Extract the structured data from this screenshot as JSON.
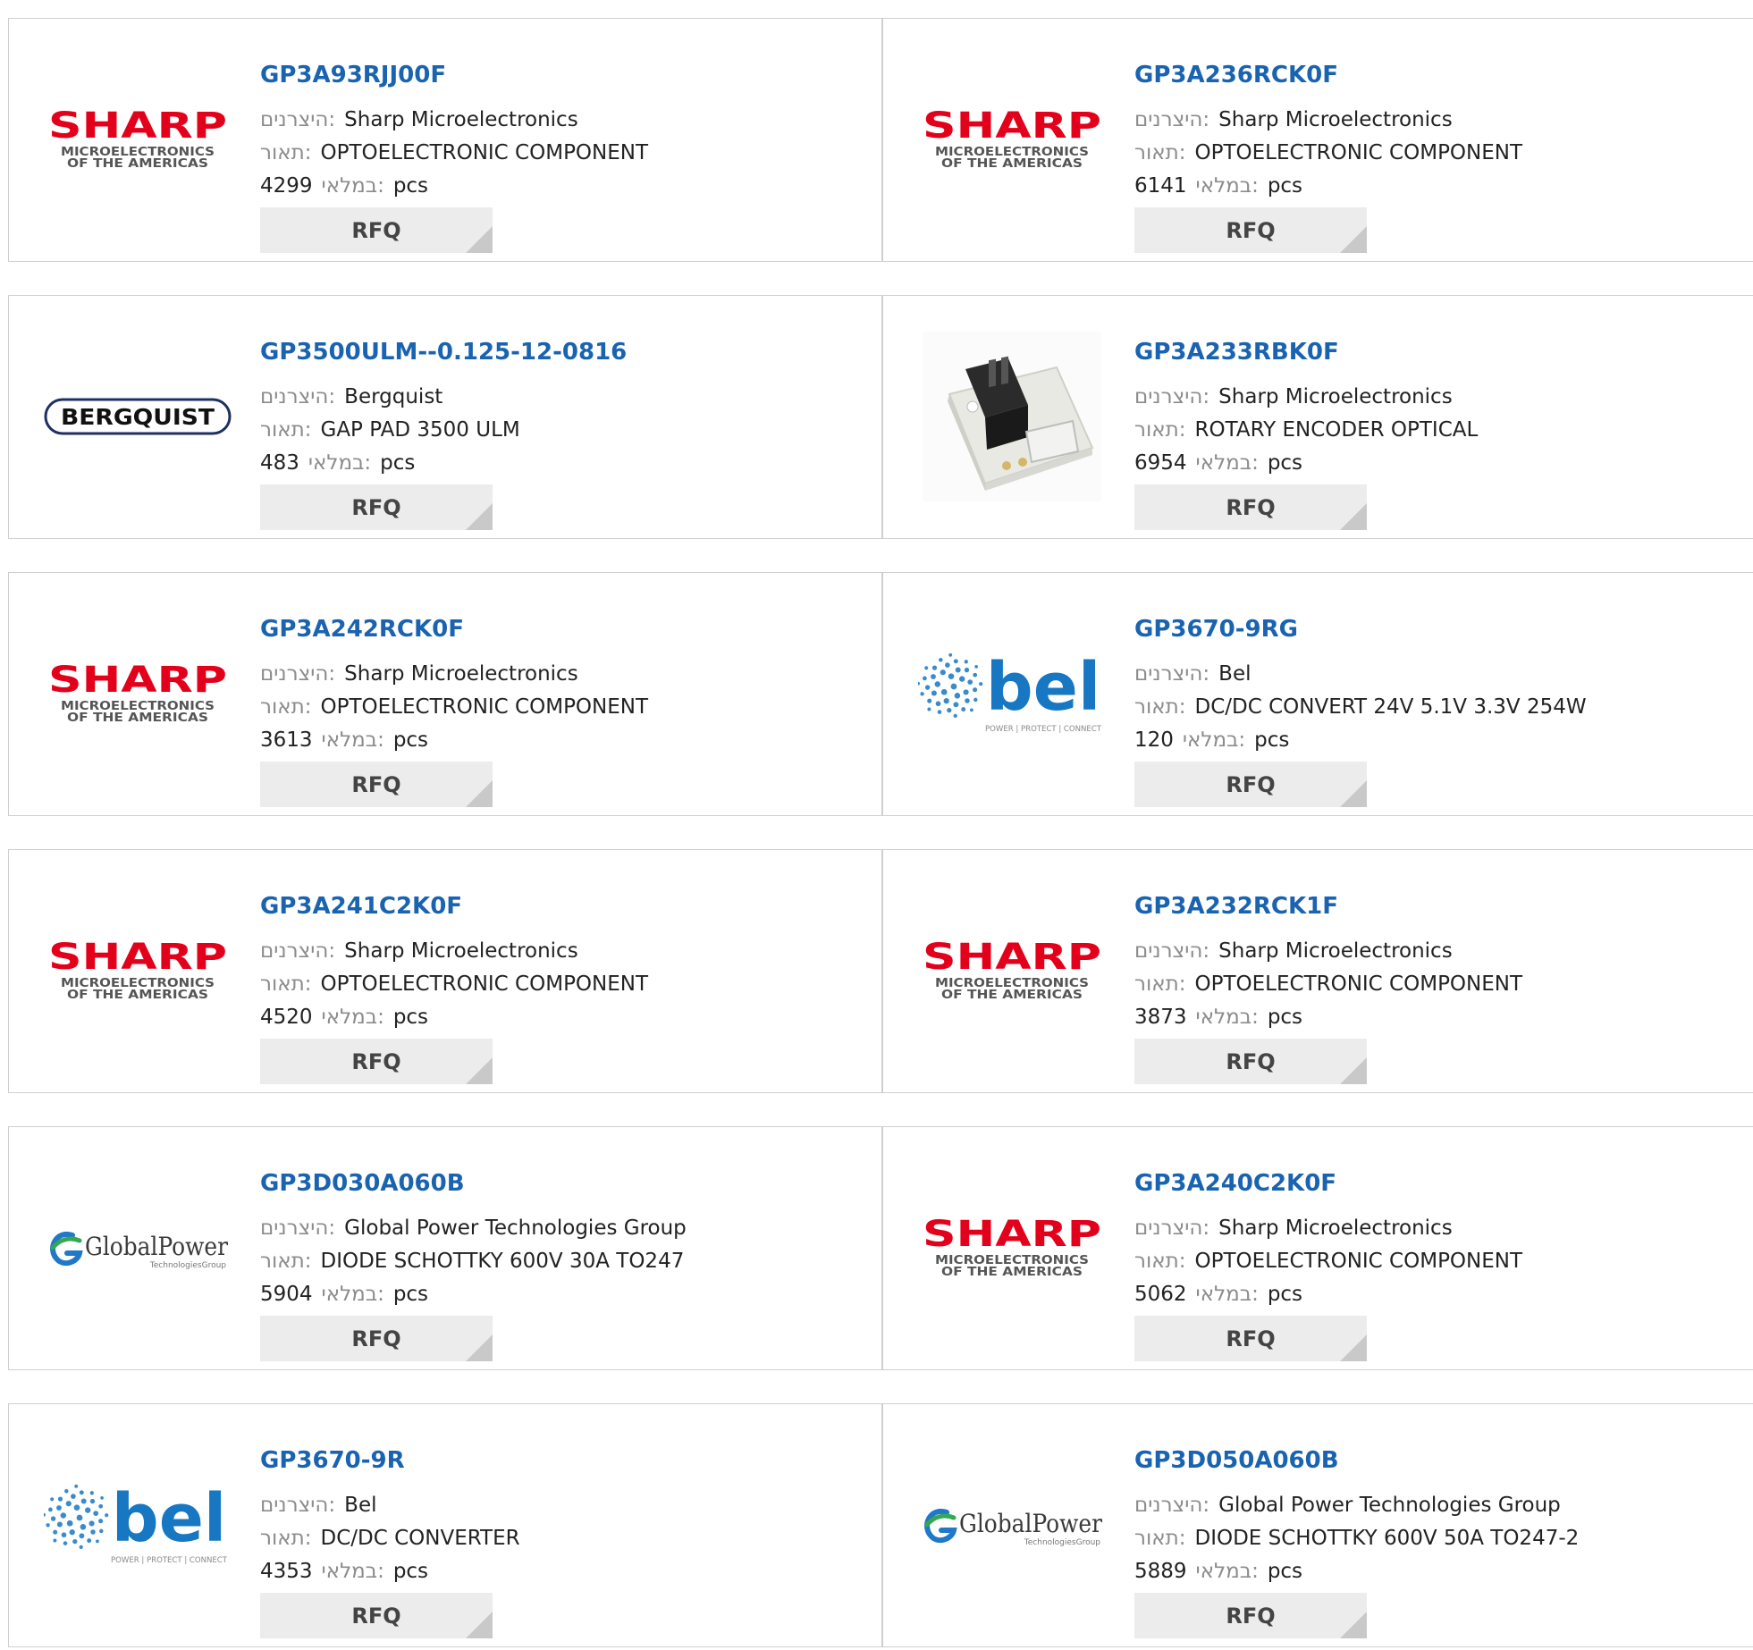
{
  "labels": {
    "manufacturer": "היצרנים:",
    "description": "תאור:",
    "stock": "במלאי:",
    "unit": "pcs",
    "rfq": "RFQ"
  },
  "logos": {
    "sharp": {
      "brand": "SHARP",
      "line1": "MICROELECTRONICS",
      "line2": "OF THE AMERICAS",
      "color": "#e3001b"
    },
    "bergquist": {
      "brand": "BERGQUIST",
      "color": "#1f2f63"
    },
    "bel": {
      "brand": "bel",
      "tagline": "POWER | PROTECT | CONNECT",
      "color": "#1777c2"
    },
    "globalpower": {
      "brand": "GlobalPower",
      "sub": "TechnologiesGroup",
      "color": "#3a3a3a"
    }
  },
  "products": [
    {
      "part": "GP3A93RJJ00F",
      "manufacturer": "Sharp Microelectronics",
      "description": "OPTOELECTRONIC COMPONENT",
      "stock": "4299",
      "logo": "sharp"
    },
    {
      "part": "GP3A236RCK0F",
      "manufacturer": "Sharp Microelectronics",
      "description": "OPTOELECTRONIC COMPONENT",
      "stock": "6141",
      "logo": "sharp"
    },
    {
      "part": "GP3500ULM--0.125-12-0816",
      "manufacturer": "Bergquist",
      "description": "GAP PAD 3500 ULM",
      "stock": "483",
      "logo": "bergquist"
    },
    {
      "part": "GP3A233RBK0F",
      "manufacturer": "Sharp Microelectronics",
      "description": "ROTARY ENCODER OPTICAL",
      "stock": "6954",
      "logo": "encoder-photo"
    },
    {
      "part": "GP3A242RCK0F",
      "manufacturer": "Sharp Microelectronics",
      "description": "OPTOELECTRONIC COMPONENT",
      "stock": "3613",
      "logo": "sharp"
    },
    {
      "part": "GP3670-9RG",
      "manufacturer": "Bel",
      "description": "DC/DC CONVERT 24V 5.1V 3.3V 254W",
      "stock": "120",
      "logo": "bel"
    },
    {
      "part": "GP3A241C2K0F",
      "manufacturer": "Sharp Microelectronics",
      "description": "OPTOELECTRONIC COMPONENT",
      "stock": "4520",
      "logo": "sharp"
    },
    {
      "part": "GP3A232RCK1F",
      "manufacturer": "Sharp Microelectronics",
      "description": "OPTOELECTRONIC COMPONENT",
      "stock": "3873",
      "logo": "sharp"
    },
    {
      "part": "GP3D030A060B",
      "manufacturer": "Global Power Technologies Group",
      "description": "DIODE SCHOTTKY 600V 30A TO247",
      "stock": "5904",
      "logo": "globalpower"
    },
    {
      "part": "GP3A240C2K0F",
      "manufacturer": "Sharp Microelectronics",
      "description": "OPTOELECTRONIC COMPONENT",
      "stock": "5062",
      "logo": "sharp"
    },
    {
      "part": "GP3670-9R",
      "manufacturer": "Bel",
      "description": "DC/DC CONVERTER",
      "stock": "4353",
      "logo": "bel"
    },
    {
      "part": "GP3D050A060B",
      "manufacturer": "Global Power Technologies Group",
      "description": "DIODE SCHOTTKY 600V 50A TO247-2",
      "stock": "5889",
      "logo": "globalpower"
    }
  ]
}
